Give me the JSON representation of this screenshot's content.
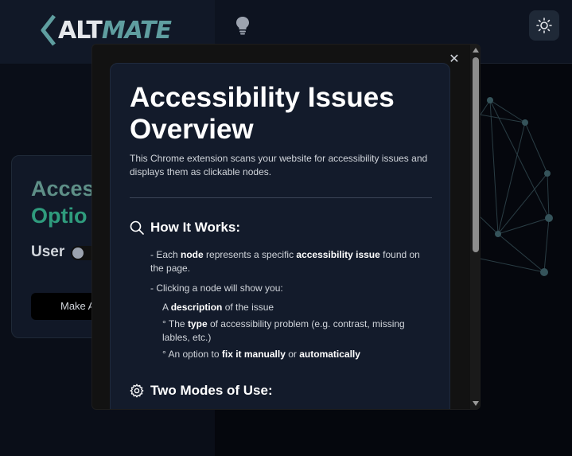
{
  "app": {
    "logo_alt": "ALT",
    "logo_mate": "MATE",
    "brand_color": "#5f9ea0"
  },
  "background_card": {
    "title_line1": "Acces",
    "title_line2": "Optio",
    "user_label": "User",
    "make_button_label": "Make A"
  },
  "modal": {
    "close_label": "✕",
    "title": "Accessibility Issues Overview",
    "description": "This Chrome extension scans your website for accessibility issues and displays them as clickable nodes.",
    "how_it_works": {
      "heading": "How It Works:",
      "icon": "search-icon",
      "item1": {
        "prefix": "- Each ",
        "bold1": "node",
        "middle": " represents a specific ",
        "bold2": "accessibility issue",
        "suffix": " found on the page."
      },
      "item2": "- Clicking a node will show you:",
      "sub1": {
        "prefix": "A ",
        "bold": "description",
        "suffix": " of the issue"
      },
      "sub2": {
        "prefix": "° The ",
        "bold": "type",
        "suffix": " of accessibility problem (e.g. contrast, missing lables, etc.)"
      },
      "sub3": {
        "prefix": "° An option to ",
        "bold1": "fix it manually",
        "middle": " or ",
        "bold2": "automatically"
      }
    },
    "two_modes": {
      "heading": "Two Modes of Use:",
      "icon": "gear-icon"
    }
  }
}
